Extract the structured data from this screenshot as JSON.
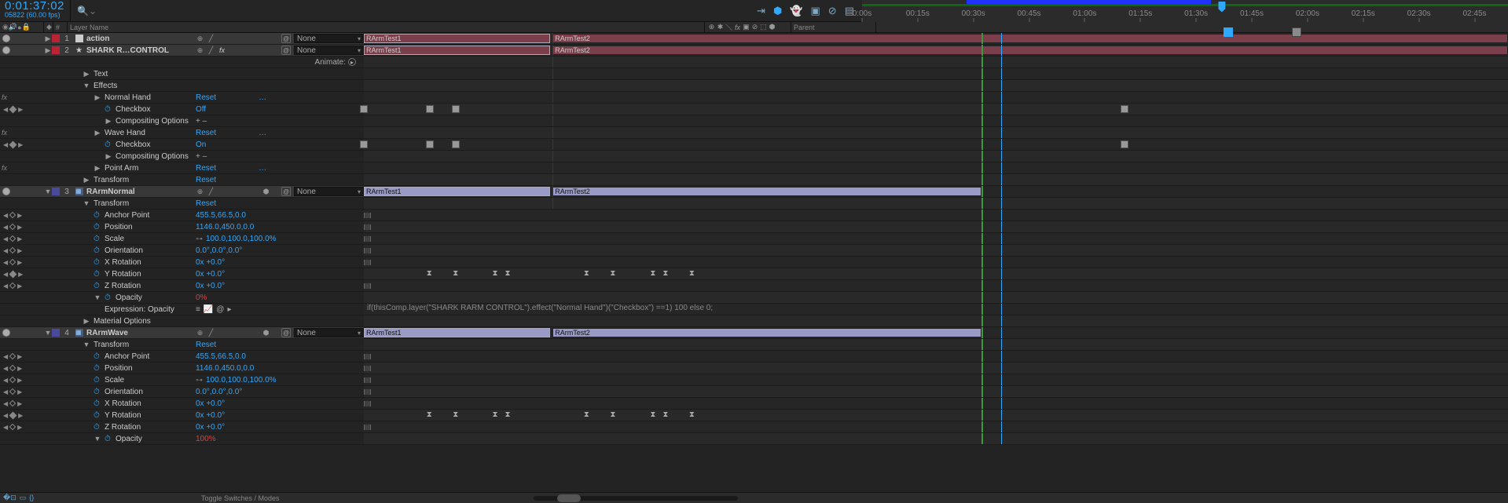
{
  "timecode": "0:01:37:02",
  "frame_info": "05822 (60.00 fps)",
  "time_ruler": {
    "ticks": [
      {
        "label": "0:00s",
        "pct": 0
      },
      {
        "label": "00:15s",
        "pct": 8.62
      },
      {
        "label": "00:30s",
        "pct": 17.24
      },
      {
        "label": "00:45s",
        "pct": 25.86
      },
      {
        "label": "01:00s",
        "pct": 34.48
      },
      {
        "label": "01:15s",
        "pct": 43.1
      },
      {
        "label": "01:30s",
        "pct": 51.72
      },
      {
        "label": "01:45s",
        "pct": 60.34
      },
      {
        "label": "02:00s",
        "pct": 68.97
      },
      {
        "label": "02:15s",
        "pct": 77.59
      },
      {
        "label": "02:30s",
        "pct": 86.21
      },
      {
        "label": "02:45s",
        "pct": 94.83
      }
    ],
    "workarea_start_pct": 16.2,
    "workarea_end_pct": 54.0,
    "workarea2_start_pct": 0,
    "workarea2_end_pct": 100,
    "cti_pct": 55.7,
    "red_cti_pct": 16.5
  },
  "columns": {
    "layer_name": "Layer Name",
    "parent": "Parent"
  },
  "layers": [
    {
      "num": "1",
      "name": "action",
      "icon": "white",
      "color": "#b23",
      "parent": "None",
      "bars": [
        {
          "label": "RArmTest1",
          "start": 0,
          "end": 16.3,
          "cls": "red sel"
        },
        {
          "label": "RArmTest2",
          "start": 16.5,
          "end": 100,
          "cls": "red"
        }
      ]
    },
    {
      "num": "2",
      "name": "SHARK R…CONTROL",
      "icon": "star",
      "color": "#b23",
      "parent": "None",
      "fx": true,
      "bars": [
        {
          "label": "RArmTest1",
          "start": 0,
          "end": 16.3,
          "cls": "red sel"
        },
        {
          "label": "RArmTest2",
          "start": 16.5,
          "end": 100,
          "cls": "red"
        }
      ],
      "sublines": [
        {
          "type": "animate"
        },
        {
          "type": "twirl",
          "label": "Text",
          "depth": 1
        },
        {
          "type": "twirl-open",
          "label": "Effects",
          "depth": 1
        },
        {
          "type": "fx",
          "label": "Normal Hand",
          "value": "Reset",
          "ellipsis": true,
          "depth": 2,
          "fxdot": true
        },
        {
          "type": "prop-kf",
          "label": "Checkbox",
          "value": "Off",
          "depth": 3,
          "stopwatch": true,
          "kfrow": "sq",
          "kfs": [
            0,
            5.75,
            8.05
          ]
        },
        {
          "type": "twirl",
          "label": "Compositing Options",
          "value": "+  –",
          "depth": 3,
          "neutral": true
        },
        {
          "type": "fx",
          "label": "Wave Hand",
          "value": "Reset",
          "ellipsis": true,
          "depth": 2,
          "fxdot": true
        },
        {
          "type": "prop-kf",
          "label": "Checkbox",
          "value": "On",
          "depth": 3,
          "stopwatch": true,
          "kfrow": "sq",
          "kfs": [
            0,
            5.75,
            8.05
          ]
        },
        {
          "type": "twirl",
          "label": "Compositing Options",
          "value": "+  –",
          "depth": 3,
          "neutral": true
        },
        {
          "type": "fx",
          "label": "Point Arm",
          "value": "Reset",
          "ellipsis": true,
          "depth": 2,
          "fxdot": true
        },
        {
          "type": "twirl",
          "label": "Transform",
          "value": "Reset",
          "depth": 1
        }
      ]
    },
    {
      "num": "3",
      "name": "RArmNormal",
      "icon": "blue",
      "color": "#4a4a9c",
      "parent": "None",
      "threeD": true,
      "bars": [
        {
          "label": "RArmTest1",
          "start": 0,
          "end": 16.3,
          "cls": "sel"
        },
        {
          "label": "RArmTest2",
          "start": 16.5,
          "end": 54.0,
          "cls": ""
        }
      ],
      "sublines": [
        {
          "type": "twirl-open",
          "label": "Transform",
          "value": "Reset",
          "depth": 1
        },
        {
          "type": "prop",
          "label": "Anchor Point",
          "value": "455.5,66.5,0.0",
          "depth": 2,
          "stopwatch": true,
          "expr": true
        },
        {
          "type": "prop",
          "label": "Position",
          "value": "1146.0,450.0,0.0",
          "depth": 2,
          "stopwatch": true,
          "expr": true
        },
        {
          "type": "prop",
          "label": "Scale",
          "value": "100.0,100.0,100.0%",
          "link": true,
          "depth": 2,
          "stopwatch": true,
          "expr": true
        },
        {
          "type": "prop",
          "label": "Orientation",
          "value": "0.0°,0.0°,0.0°",
          "depth": 2,
          "stopwatch": true,
          "expr": true
        },
        {
          "type": "prop",
          "label": "X Rotation",
          "value": "0x +0.0°",
          "depth": 2,
          "stopwatch": true,
          "expr": true
        },
        {
          "type": "prop-kf",
          "label": "Y Rotation",
          "value": "0x +0.0°",
          "depth": 2,
          "stopwatch": true,
          "kfrow": "hour",
          "kfs": [
            5.75,
            8.05,
            11.5,
            12.6,
            19.5,
            21.8,
            25.3,
            26.4,
            28.7
          ]
        },
        {
          "type": "prop",
          "label": "Z Rotation",
          "value": "0x +0.0°",
          "depth": 2,
          "stopwatch": true,
          "expr": true
        },
        {
          "type": "twirl-open",
          "label": "Opacity",
          "value": "0%",
          "depth": 2,
          "red": true,
          "stopwatch": true
        },
        {
          "type": "expr-line",
          "label": "Expression: Opacity",
          "depth": 3,
          "exprtools": true,
          "source": "if(thisComp.layer(\"SHARK RARM CONTROL\").effect(\"Normal Hand\")(\"Checkbox\") ==1) 100 else 0;"
        },
        {
          "type": "twirl",
          "label": "Material Options",
          "depth": 1
        }
      ]
    },
    {
      "num": "4",
      "name": "RArmWave",
      "icon": "blue",
      "color": "#4a4a9c",
      "parent": "None",
      "threeD": true,
      "bars": [
        {
          "label": "RArmTest1",
          "start": 0,
          "end": 16.3,
          "cls": "sel"
        },
        {
          "label": "RArmTest2",
          "start": 16.5,
          "end": 54.0,
          "cls": ""
        }
      ],
      "sublines": [
        {
          "type": "twirl-open",
          "label": "Transform",
          "value": "Reset",
          "depth": 1
        },
        {
          "type": "prop",
          "label": "Anchor Point",
          "value": "455.5,66.5,0.0",
          "depth": 2,
          "stopwatch": true,
          "expr": true
        },
        {
          "type": "prop",
          "label": "Position",
          "value": "1146.0,450.0,0.0",
          "depth": 2,
          "stopwatch": true,
          "expr": true
        },
        {
          "type": "prop",
          "label": "Scale",
          "value": "100.0,100.0,100.0%",
          "link": true,
          "depth": 2,
          "stopwatch": true,
          "expr": true
        },
        {
          "type": "prop",
          "label": "Orientation",
          "value": "0.0°,0.0°,0.0°",
          "depth": 2,
          "stopwatch": true,
          "expr": true
        },
        {
          "type": "prop",
          "label": "X Rotation",
          "value": "0x +0.0°",
          "depth": 2,
          "stopwatch": true,
          "expr": true
        },
        {
          "type": "prop-kf",
          "label": "Y Rotation",
          "value": "0x +0.0°",
          "depth": 2,
          "stopwatch": true,
          "kfrow": "hour",
          "kfs": [
            5.75,
            8.05,
            11.5,
            12.6,
            19.5,
            21.8,
            25.3,
            26.4,
            28.7
          ]
        },
        {
          "type": "prop",
          "label": "Z Rotation",
          "value": "0x +0.0°",
          "depth": 2,
          "stopwatch": true,
          "expr": true
        },
        {
          "type": "twirl-open-cut",
          "label": "Opacity",
          "value": "100%",
          "depth": 2,
          "red": true,
          "stopwatch": true
        }
      ]
    }
  ],
  "footer": {
    "toggle": "Toggle Switches / Modes"
  },
  "markers": {
    "in_pct": 54.0,
    "cti_pct": 55.7,
    "kf_marker_pcts": []
  },
  "overlay_markers": {
    "greens": [
      54.0
    ],
    "blue": 55.7,
    "cyan_tab_pct": 66.5
  }
}
